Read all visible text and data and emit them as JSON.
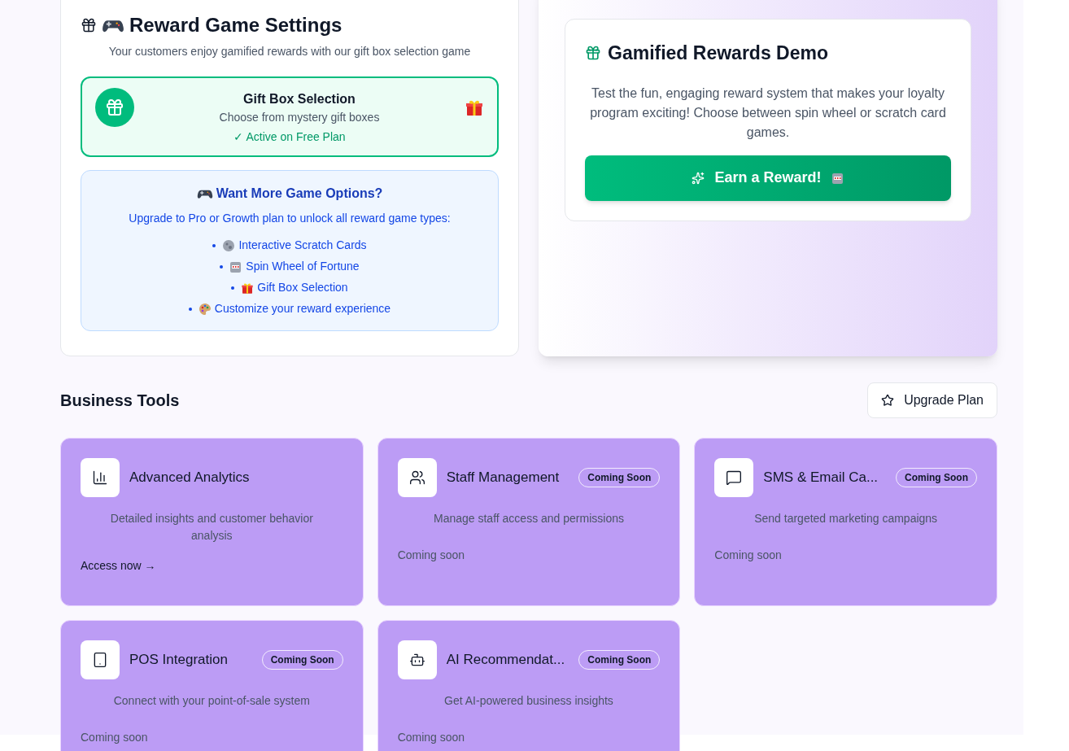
{
  "reward_settings": {
    "title": "Reward Game Settings",
    "subtitle": "Your customers enjoy gamified rewards with our gift box selection game",
    "active_game": {
      "name": "Gift Box Selection",
      "description": "Choose from mystery gift boxes",
      "status": "✓ Active on Free Plan",
      "active": true
    },
    "upgrade_box": {
      "title": "Want More Game Options?",
      "text": "Upgrade to Pro or Growth plan to unlock all reward game types:",
      "items": [
        {
          "label": "Interactive Scratch Cards"
        },
        {
          "label": "Spin Wheel of Fortune"
        },
        {
          "label": "Gift Box Selection"
        },
        {
          "label": "Customize your reward experience"
        }
      ]
    }
  },
  "demo": {
    "title": "Gamified Rewards Demo",
    "text": "Test the fun, engaging reward system that makes your loyalty program exciting! Choose between spin wheel or scratch card games.",
    "button": "Earn a Reward!"
  },
  "business_tools": {
    "title": "Business Tools",
    "upgrade_button": "Upgrade Plan",
    "tools": [
      {
        "name": "Advanced Analytics",
        "description": "Detailed insights and customer behavior analysis",
        "kind": "available",
        "action": "Access now →"
      },
      {
        "name": "Staff Management",
        "badge": "Coming Soon",
        "description": "Manage staff access and permissions",
        "kind": "coming_soon",
        "action": "Coming soon"
      },
      {
        "name": "SMS & Email Ca...",
        "badge": "Coming Soon",
        "description": "Send targeted marketing campaigns",
        "kind": "coming_soon",
        "action": "Coming soon"
      },
      {
        "name": "POS Integration",
        "badge": "Coming Soon",
        "description": "Connect with your point-of-sale system",
        "kind": "coming_soon",
        "action": "Coming soon"
      },
      {
        "name": "AI Recommendat...",
        "badge": "Coming Soon",
        "description": "Get AI-powered business insights",
        "kind": "coming_soon",
        "action": "Coming soon"
      }
    ]
  }
}
